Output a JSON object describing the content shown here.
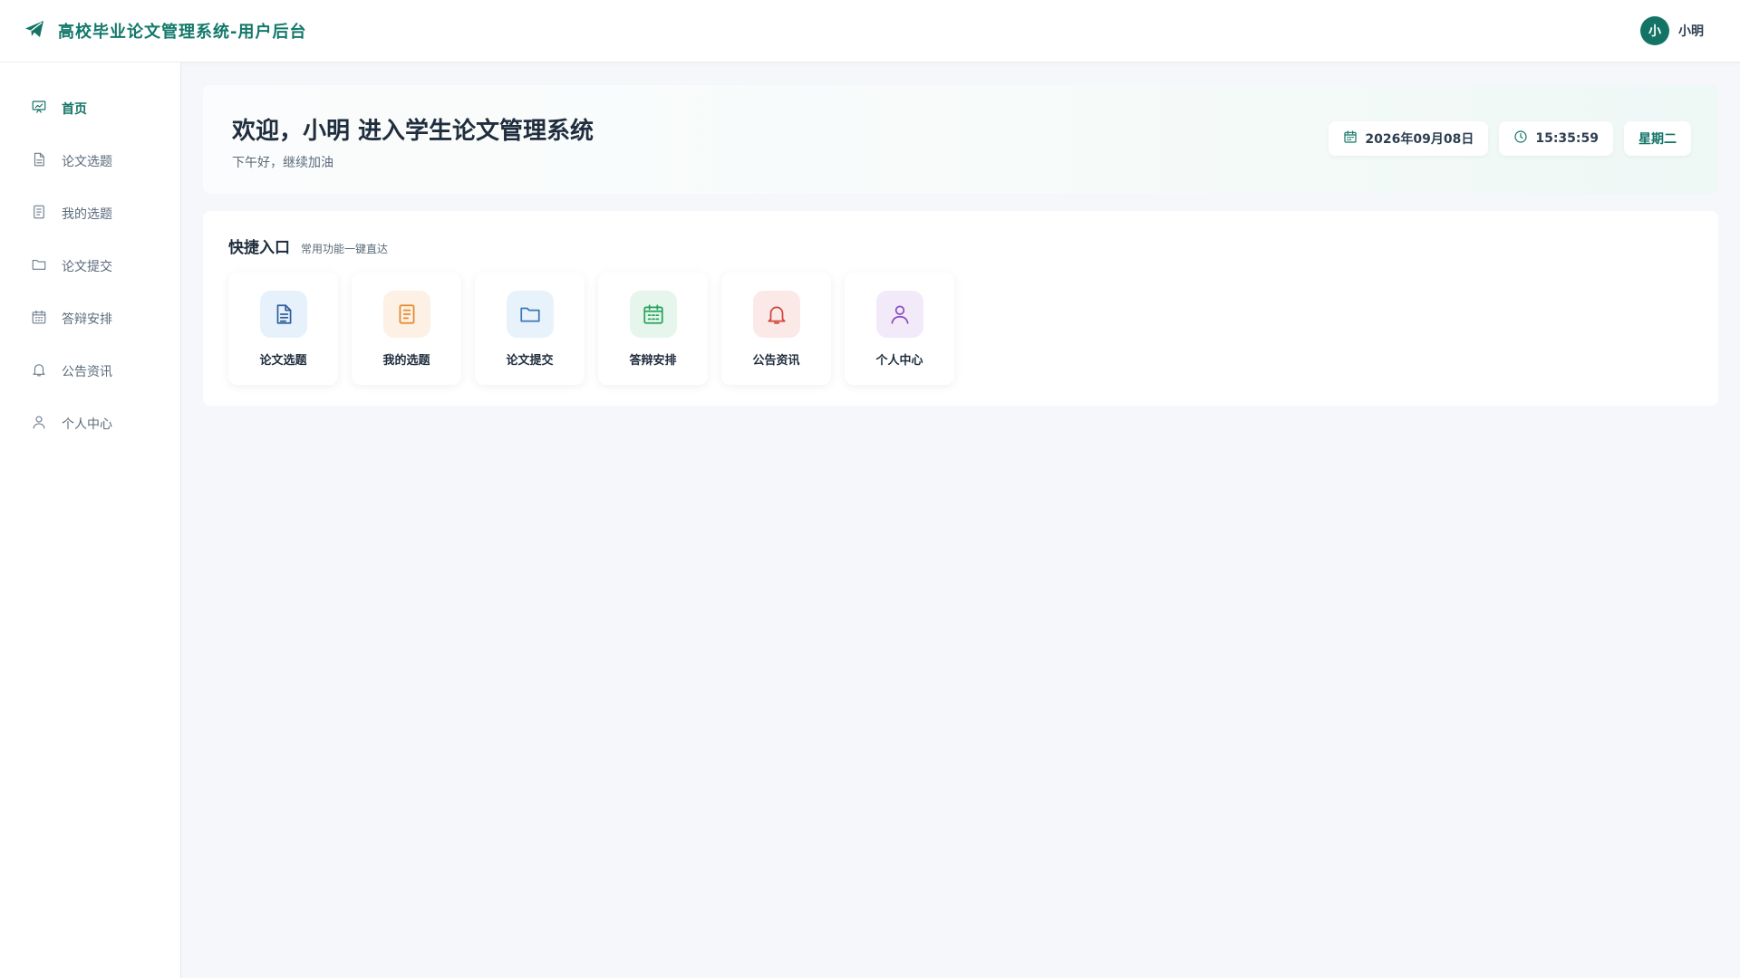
{
  "header": {
    "title": "高校毕业论文管理系统-用户后台",
    "logo_icon": "paper-plane-icon",
    "brand_color": "#12786a",
    "user": {
      "avatar_text": "小",
      "name": "小明"
    }
  },
  "sidebar": {
    "items": [
      {
        "label": "首页",
        "icon": "presentation-chart-icon",
        "active": true
      },
      {
        "label": "论文选题",
        "icon": "document-icon",
        "active": false
      },
      {
        "label": "我的选题",
        "icon": "document-list-icon",
        "active": false
      },
      {
        "label": "论文提交",
        "icon": "folder-icon",
        "active": false
      },
      {
        "label": "答辩安排",
        "icon": "calendar-icon",
        "active": false
      },
      {
        "label": "公告资讯",
        "icon": "bell-icon",
        "active": false
      },
      {
        "label": "个人中心",
        "icon": "user-icon",
        "active": false
      }
    ]
  },
  "welcome": {
    "title": "欢迎，小明 进入学生论文管理系统",
    "subtitle": "下午好，继续加油",
    "date": "2026年09月08日",
    "time": "15:35:59",
    "weekday": "星期二"
  },
  "quick": {
    "title": "快捷入口",
    "subtitle": "常用功能一键直达",
    "tiles": [
      {
        "label": "论文选题",
        "icon": "document-icon",
        "color": "#2f5f9e",
        "bg": "#e7f1fb"
      },
      {
        "label": "我的选题",
        "icon": "document-list-icon",
        "color": "#e8892b",
        "bg": "#fdf0e4"
      },
      {
        "label": "论文提交",
        "icon": "folder-icon",
        "color": "#3a78b5",
        "bg": "#e8f2fb"
      },
      {
        "label": "答辩安排",
        "icon": "calendar-icon",
        "color": "#27a35a",
        "bg": "#e6f6ec"
      },
      {
        "label": "公告资讯",
        "icon": "bell-icon",
        "color": "#d2413a",
        "bg": "#fbe9e8"
      },
      {
        "label": "个人中心",
        "icon": "user-icon",
        "color": "#8a4fc0",
        "bg": "#f2eaf9"
      }
    ]
  }
}
